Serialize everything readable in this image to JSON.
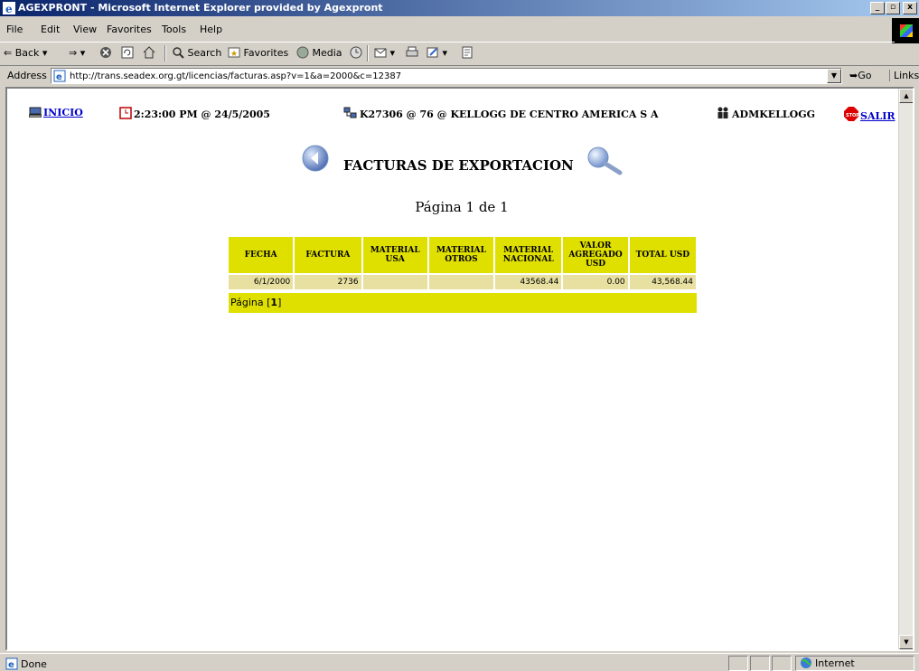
{
  "window": {
    "title": "AGEXPRONT - Microsoft Internet Explorer provided by Agexpront"
  },
  "menu": [
    "File",
    "Edit",
    "View",
    "Favorites",
    "Tools",
    "Help"
  ],
  "toolbar": {
    "back": "Back",
    "search": "Search",
    "favorites": "Favorites",
    "media": "Media"
  },
  "address": {
    "label": "Address",
    "url": "http://trans.seadex.org.gt/licencias/facturas.asp?v=1&a=2000&c=12387",
    "go": "Go",
    "links": "Links"
  },
  "header": {
    "inicio": "INICIO",
    "datetime": "2:23:00 PM @ 24/5/2005",
    "company": "K27306 @ 76 @ KELLOGG DE CENTRO AMERICA S A",
    "user": "ADMKELLOGG",
    "salir": "SALIR"
  },
  "page": {
    "title": "FACTURAS DE EXPORTACION",
    "pager_top": "Página 1 de 1"
  },
  "table": {
    "headers": [
      "FECHA",
      "FACTURA",
      "MATERIAL USA",
      "MATERIAL OTROS",
      "MATERIAL NACIONAL",
      "VALOR AGREGADO USD",
      "TOTAL USD"
    ],
    "rows": [
      [
        "6/1/2000",
        "2736",
        "",
        "",
        "43568.44",
        "0.00",
        "43,568.44"
      ]
    ]
  },
  "pager_bottom": {
    "prefix": "Página [",
    "page": "1",
    "suffix": "]"
  },
  "status": {
    "text": "Done",
    "zone": "Internet"
  },
  "colors": {
    "titlebar": "#0a246a",
    "header_cell": "#e0e000",
    "data_cell": "#e8e0a0",
    "link": "#0000cc"
  }
}
